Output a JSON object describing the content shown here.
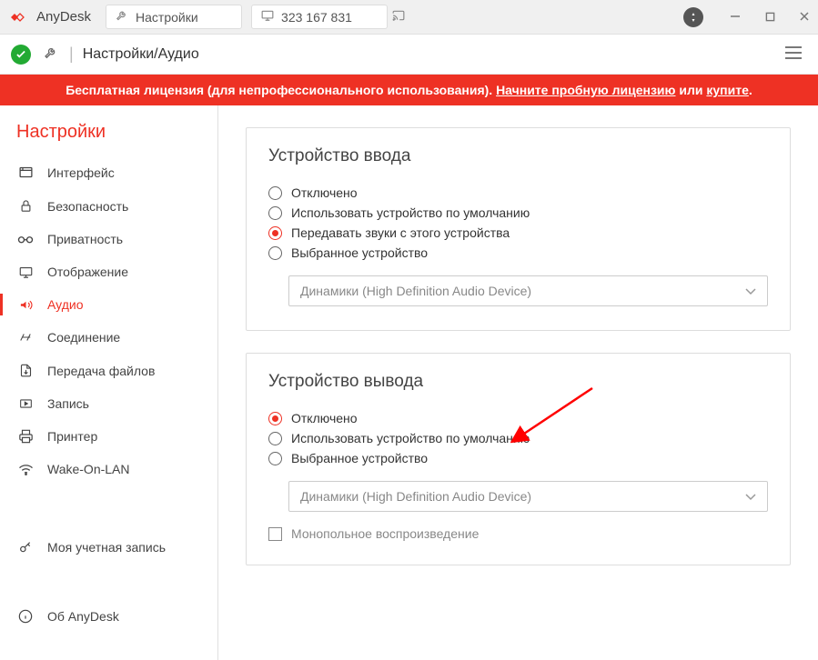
{
  "titlebar": {
    "app_name": "AnyDesk",
    "tabs": [
      {
        "icon": "wrench",
        "label": "Настройки"
      },
      {
        "icon": "monitor",
        "label": "323 167 831"
      }
    ]
  },
  "toolbar": {
    "breadcrumb": "Настройки/Аудио"
  },
  "banner": {
    "text1": "Бесплатная лицензия (для непрофессионального использования).",
    "link1": "Начните пробную лицензию",
    "or": "или",
    "link2": "купите"
  },
  "sidebar": {
    "title": "Настройки",
    "items": [
      {
        "icon": "interface",
        "label": "Интерфейс"
      },
      {
        "icon": "lock",
        "label": "Безопасность"
      },
      {
        "icon": "glasses",
        "label": "Приватность"
      },
      {
        "icon": "monitor",
        "label": "Отображение"
      },
      {
        "icon": "audio",
        "label": "Аудио",
        "active": true
      },
      {
        "icon": "link",
        "label": "Соединение"
      },
      {
        "icon": "filetransfer",
        "label": "Передача файлов"
      },
      {
        "icon": "record",
        "label": "Запись"
      },
      {
        "icon": "printer",
        "label": "Принтер"
      },
      {
        "icon": "wol",
        "label": "Wake-On-LAN"
      }
    ],
    "bottom_items": [
      {
        "icon": "key",
        "label": "Моя учетная запись"
      },
      {
        "icon": "info",
        "label": "Об AnyDesk"
      }
    ]
  },
  "content": {
    "input_device": {
      "title": "Устройство ввода",
      "options": [
        {
          "label": "Отключено",
          "checked": false
        },
        {
          "label": "Использовать устройство по умолчанию",
          "checked": false
        },
        {
          "label": "Передавать звуки с этого устройства",
          "checked": true
        },
        {
          "label": "Выбранное устройство",
          "checked": false
        }
      ],
      "select_value": "Динамики (High Definition Audio Device)"
    },
    "output_device": {
      "title": "Устройство вывода",
      "options": [
        {
          "label": "Отключено",
          "checked": true
        },
        {
          "label": "Использовать устройство по умолчанию",
          "checked": false
        },
        {
          "label": "Выбранное устройство",
          "checked": false
        }
      ],
      "select_value": "Динамики (High Definition Audio Device)",
      "checkbox_label": "Монопольное воспроизведение",
      "checkbox_checked": false
    }
  }
}
